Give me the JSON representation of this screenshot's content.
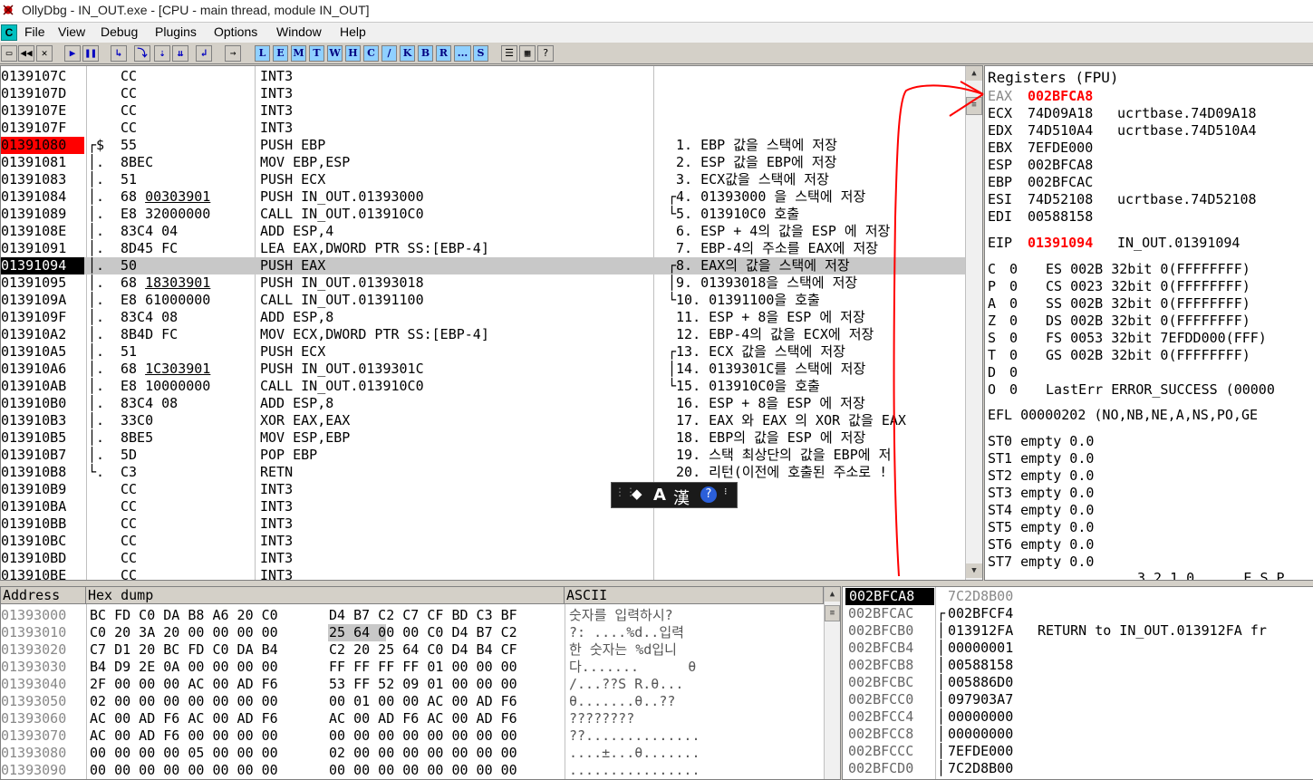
{
  "window": {
    "title": "OllyDbg - IN_OUT.exe - [CPU - main thread, module IN_OUT]"
  },
  "menu": [
    "File",
    "View",
    "Debug",
    "Plugins",
    "Options",
    "Window",
    "Help"
  ],
  "toolbar": {
    "letters": [
      "L",
      "E",
      "M",
      "T",
      "W",
      "H",
      "C",
      "/",
      "K",
      "B",
      "R",
      "...",
      "S"
    ]
  },
  "colors": {
    "red_highlight": "#ff0000",
    "selected": "#000000",
    "annotation": "#ff0000",
    "teal": "#00c0c0"
  },
  "cpu": {
    "rows": [
      {
        "addr": "0139107C",
        "gut": "",
        "hex": "CC",
        "dis": "INT3",
        "cmt": ""
      },
      {
        "addr": "0139107D",
        "gut": "",
        "hex": "CC",
        "dis": "INT3",
        "cmt": ""
      },
      {
        "addr": "0139107E",
        "gut": "",
        "hex": "CC",
        "dis": "INT3",
        "cmt": ""
      },
      {
        "addr": "0139107F",
        "gut": "",
        "hex": "CC",
        "dis": "INT3",
        "cmt": ""
      },
      {
        "addr": "01391080",
        "gut": "┌$",
        "hex": "55",
        "dis": "PUSH EBP",
        "cmt": " 1. EBP 값을 스택에 저장"
      },
      {
        "addr": "01391081",
        "gut": "│.",
        "hex": "8BEC",
        "dis": "MOV EBP,ESP",
        "cmt": " 2. ESP 값을 EBP에 저장"
      },
      {
        "addr": "01391083",
        "gut": "│.",
        "hex": "51",
        "dis": "PUSH ECX",
        "cmt": " 3. ECX값을 스택에 저장"
      },
      {
        "addr": "01391084",
        "gut": "│.",
        "hex": "68 00303901",
        "dis": "PUSH IN_OUT.01393000",
        "cmt": "┌4. 01393000 을 스택에 저장"
      },
      {
        "addr": "01391089",
        "gut": "│.",
        "hex": "E8 32000000",
        "dis": "CALL IN_OUT.013910C0",
        "cmt": "└5. 013910C0 호출"
      },
      {
        "addr": "0139108E",
        "gut": "│.",
        "hex": "83C4 04",
        "dis": "ADD ESP,4",
        "cmt": " 6. ESP + 4의 값을 ESP 에 저장"
      },
      {
        "addr": "01391091",
        "gut": "│.",
        "hex": "8D45 FC",
        "dis": "LEA EAX,DWORD PTR SS:[EBP-4]",
        "cmt": " 7. EBP-4의 주소를 EAX에 저장"
      },
      {
        "addr": "01391094",
        "gut": "│.",
        "hex": "50",
        "dis": "PUSH EAX",
        "cmt": "┌8. EAX의 값을 스택에 저장"
      },
      {
        "addr": "01391095",
        "gut": "│.",
        "hex": "68 18303901",
        "dis": "PUSH IN_OUT.01393018",
        "cmt": "│9. 01393018을 스택에 저장"
      },
      {
        "addr": "0139109A",
        "gut": "│.",
        "hex": "E8 61000000",
        "dis": "CALL IN_OUT.01391100",
        "cmt": "└10. 01391100을 호출"
      },
      {
        "addr": "0139109F",
        "gut": "│.",
        "hex": "83C4 08",
        "dis": "ADD ESP,8",
        "cmt": " 11. ESP + 8을 ESP 에 저장"
      },
      {
        "addr": "013910A2",
        "gut": "│.",
        "hex": "8B4D FC",
        "dis": "MOV ECX,DWORD PTR SS:[EBP-4]",
        "cmt": " 12. EBP-4의 값을 ECX에 저장"
      },
      {
        "addr": "013910A5",
        "gut": "│.",
        "hex": "51",
        "dis": "PUSH ECX",
        "cmt": "┌13. ECX 값을 스택에 저장"
      },
      {
        "addr": "013910A6",
        "gut": "│.",
        "hex": "68 1C303901",
        "dis": "PUSH IN_OUT.0139301C",
        "cmt": "│14. 0139301C를 스택에 저장"
      },
      {
        "addr": "013910AB",
        "gut": "│.",
        "hex": "E8 10000000",
        "dis": "CALL IN_OUT.013910C0",
        "cmt": "└15. 013910C0을 호출"
      },
      {
        "addr": "013910B0",
        "gut": "│.",
        "hex": "83C4 08",
        "dis": "ADD ESP,8",
        "cmt": " 16. ESP + 8을 ESP 에 저장"
      },
      {
        "addr": "013910B3",
        "gut": "│.",
        "hex": "33C0",
        "dis": "XOR EAX,EAX",
        "cmt": " 17. EAX 와 EAX 의 XOR 값을 EAX"
      },
      {
        "addr": "013910B5",
        "gut": "│.",
        "hex": "8BE5",
        "dis": "MOV ESP,EBP",
        "cmt": " 18. EBP의 값을 ESP 에 저장"
      },
      {
        "addr": "013910B7",
        "gut": "│.",
        "hex": "5D",
        "dis": "POP EBP",
        "cmt": " 19. 스택 최상단의 값을 EBP에 저"
      },
      {
        "addr": "013910B8",
        "gut": "└.",
        "hex": "C3",
        "dis": "RETN",
        "cmt": " 20. 리턴(이전에 호출된 주소로 !"
      },
      {
        "addr": "013910B9",
        "gut": "",
        "hex": "CC",
        "dis": "INT3",
        "cmt": ""
      },
      {
        "addr": "013910BA",
        "gut": "",
        "hex": "CC",
        "dis": "INT3",
        "cmt": ""
      },
      {
        "addr": "013910BB",
        "gut": "",
        "hex": "CC",
        "dis": "INT3",
        "cmt": ""
      },
      {
        "addr": "013910BC",
        "gut": "",
        "hex": "CC",
        "dis": "INT3",
        "cmt": ""
      },
      {
        "addr": "013910BD",
        "gut": "",
        "hex": "CC",
        "dis": "INT3",
        "cmt": ""
      },
      {
        "addr": "013910BE",
        "gut": "",
        "hex": "CC",
        "dis": "INT3",
        "cmt": ""
      }
    ],
    "red_addr": "01391080",
    "selected_addr": "01391094"
  },
  "registers": {
    "title": "Registers (FPU)",
    "gp": [
      {
        "name": "EAX",
        "value": "002BFCA8",
        "info": "",
        "changed": true
      },
      {
        "name": "ECX",
        "value": "74D09A18",
        "info": "ucrtbase.74D09A18",
        "changed": false
      },
      {
        "name": "EDX",
        "value": "74D510A4",
        "info": "ucrtbase.74D510A4",
        "changed": false
      },
      {
        "name": "EBX",
        "value": "7EFDE000",
        "info": "",
        "changed": false
      },
      {
        "name": "ESP",
        "value": "002BFCA8",
        "info": "",
        "changed": false
      },
      {
        "name": "EBP",
        "value": "002BFCAC",
        "info": "",
        "changed": false
      },
      {
        "name": "ESI",
        "value": "74D52108",
        "info": "ucrtbase.74D52108",
        "changed": false
      },
      {
        "name": "EDI",
        "value": "00588158",
        "info": "",
        "changed": false
      }
    ],
    "eip": {
      "name": "EIP",
      "value": "01391094",
      "info": "IN_OUT.01391094"
    },
    "flags": [
      {
        "f": "C",
        "v": "0",
        "seg": "ES 002B 32bit 0(FFFFFFFF)"
      },
      {
        "f": "P",
        "v": "0",
        "seg": "CS 0023 32bit 0(FFFFFFFF)"
      },
      {
        "f": "A",
        "v": "0",
        "seg": "SS 002B 32bit 0(FFFFFFFF)"
      },
      {
        "f": "Z",
        "v": "0",
        "seg": "DS 002B 32bit 0(FFFFFFFF)"
      },
      {
        "f": "S",
        "v": "0",
        "seg": "FS 0053 32bit 7EFDD000(FFF)"
      },
      {
        "f": "T",
        "v": "0",
        "seg": "GS 002B 32bit 0(FFFFFFFF)"
      },
      {
        "f": "D",
        "v": "0",
        "seg": ""
      },
      {
        "f": "O",
        "v": "0",
        "seg": "LastErr ERROR_SUCCESS (00000"
      }
    ],
    "efl": "EFL 00000202 (NO,NB,NE,A,NS,PO,GE",
    "fpu": [
      "ST0 empty 0.0",
      "ST1 empty 0.0",
      "ST2 empty 0.0",
      "ST3 empty 0.0",
      "ST4 empty 0.0",
      "ST5 empty 0.0",
      "ST6 empty 0.0",
      "ST7 empty 0.0"
    ],
    "fpu_footer": "3 2 1 0      E S P"
  },
  "dump": {
    "headers": {
      "address": "Address",
      "hex": "Hex dump",
      "ascii": "ASCII"
    },
    "rows": [
      {
        "addr": "01393000",
        "hex1": "BC FD C0 DA B8 A6 20 C0",
        "hex2": "D4 B7 C2 C7 CF BD C3 BF",
        "ascii": "숫자를 입력하시?"
      },
      {
        "addr": "01393010",
        "hex1": "C0 20 3A 20 00 00 00 00",
        "hex2": "25 64 00 00 C0 D4 B7 C2",
        "ascii": "?: ....%d..입력"
      },
      {
        "addr": "01393020",
        "hex1": "C7 D1 20 BC FD C0 DA B4",
        "hex2": "C2 20 25 64 C0 D4 B4 CF",
        "ascii": "한 숫자는 %d입니"
      },
      {
        "addr": "01393030",
        "hex1": "B4 D9 2E 0A 00 00 00 00",
        "hex2": "FF FF FF FF 01 00 00 00",
        "ascii": "다.......      θ"
      },
      {
        "addr": "01393040",
        "hex1": "2F 00 00 00 AC 00 AD F6",
        "hex2": "53 FF 52 09 01 00 00 00",
        "ascii": "/...??S R.θ..."
      },
      {
        "addr": "01393050",
        "hex1": "02 00 00 00 00 00 00 00",
        "hex2": "00 01 00 00 AC 00 AD F6",
        "ascii": "θ.......θ..??"
      },
      {
        "addr": "01393060",
        "hex1": "AC 00 AD F6 AC 00 AD F6",
        "hex2": "AC 00 AD F6 AC 00 AD F6",
        "ascii": "????????"
      },
      {
        "addr": "01393070",
        "hex1": "AC 00 AD F6 00 00 00 00",
        "hex2": "00 00 00 00 00 00 00 00",
        "ascii": "??.............."
      },
      {
        "addr": "01393080",
        "hex1": "00 00 00 00 05 00 00 00",
        "hex2": "02 00 00 00 00 00 00 00",
        "ascii": "....±...θ......."
      },
      {
        "addr": "01393090",
        "hex1": "00 00 00 00 00 00 00 00",
        "hex2": "00 00 00 00 00 00 00 00",
        "ascii": "................"
      }
    ]
  },
  "stack": {
    "header_addr": "002BFCA8",
    "header_val": "7C2D8B00",
    "rows": [
      {
        "addr": "002BFCAC",
        "gut": "┌",
        "val": "002BFCF4",
        "cmt": ""
      },
      {
        "addr": "002BFCB0",
        "gut": "│",
        "val": "013912FA",
        "cmt": "RETURN to IN_OUT.013912FA fr"
      },
      {
        "addr": "002BFCB4",
        "gut": "│",
        "val": "00000001",
        "cmt": ""
      },
      {
        "addr": "002BFCB8",
        "gut": "│",
        "val": "00588158",
        "cmt": ""
      },
      {
        "addr": "002BFCBC",
        "gut": "│",
        "val": "005886D0",
        "cmt": ""
      },
      {
        "addr": "002BFCC0",
        "gut": "│",
        "val": "097903A7",
        "cmt": ""
      },
      {
        "addr": "002BFCC4",
        "gut": "│",
        "val": "00000000",
        "cmt": ""
      },
      {
        "addr": "002BFCC8",
        "gut": "│",
        "val": "00000000",
        "cmt": ""
      },
      {
        "addr": "002BFCCC",
        "gut": "│",
        "val": "7EFDE000",
        "cmt": ""
      },
      {
        "addr": "002BFCD0",
        "gut": "│",
        "val": "7C2D8B00",
        "cmt": ""
      }
    ]
  },
  "ime": {
    "mode": "A",
    "hanja": "漢",
    "help": "?"
  }
}
